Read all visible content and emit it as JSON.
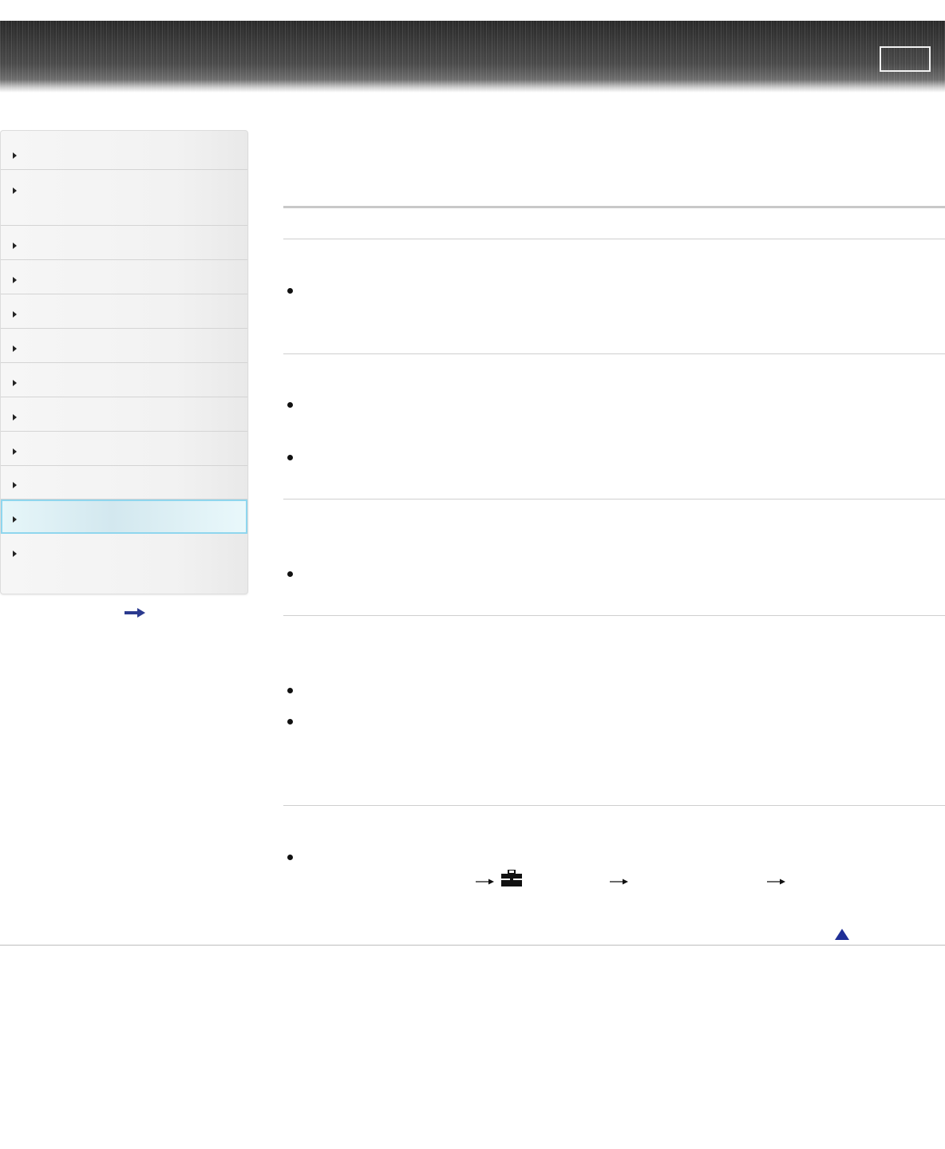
{
  "header": {
    "title": "",
    "button_label": ""
  },
  "sidebar": {
    "items": [
      {
        "label": ""
      },
      {
        "label": ""
      },
      {
        "label": ""
      },
      {
        "label": ""
      },
      {
        "label": ""
      },
      {
        "label": ""
      },
      {
        "label": ""
      },
      {
        "label": ""
      },
      {
        "label": ""
      },
      {
        "label": ""
      },
      {
        "label": "",
        "active": true
      },
      {
        "label": ""
      }
    ],
    "more_link": {
      "icon": "right-arrow-icon",
      "color": "#2b3a8f"
    }
  },
  "main": {
    "page_title": "",
    "sections": [
      {
        "heading": "",
        "bullets": [
          ""
        ]
      },
      {
        "heading": "",
        "bullets": [
          "",
          ""
        ]
      },
      {
        "heading": "",
        "bullets": [
          ""
        ]
      },
      {
        "heading": "",
        "bullets": [
          "",
          ""
        ]
      },
      {
        "heading": "",
        "bullets": [
          ""
        ],
        "menu_path_icons": [
          "right-arrow-icon",
          "toolbox-icon",
          "right-arrow-icon",
          "right-arrow-icon"
        ]
      }
    ]
  },
  "footer": {
    "back_to_top_icon": "up-triangle-icon",
    "accent_color": "#1f2f96"
  }
}
